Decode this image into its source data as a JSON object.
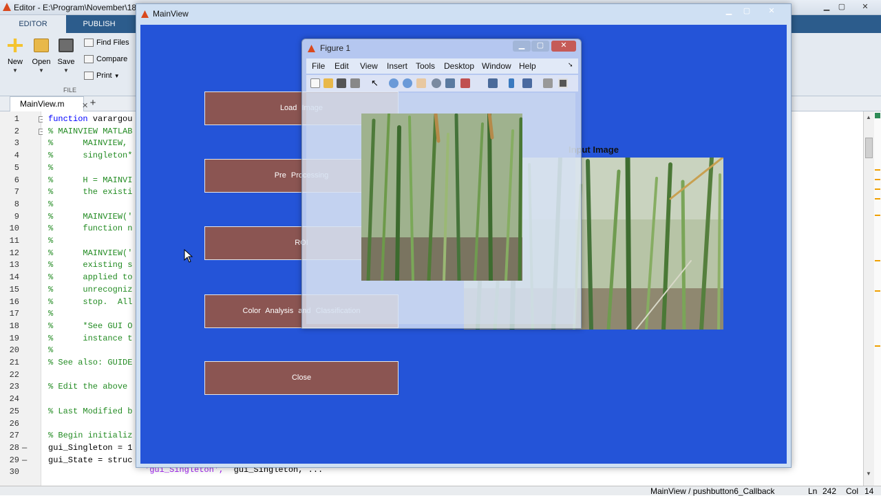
{
  "editor": {
    "title": "Editor - E:\\Program\\November\\18-",
    "tabs": [
      "EDITOR",
      "PUBLISH"
    ],
    "toolbar": {
      "new_label": "New",
      "open_label": "Open",
      "save_label": "Save",
      "find_files_label": "Find Files",
      "compare_label": "Compare",
      "print_label": "Print",
      "group_label": "FILE"
    },
    "doc_tab": "MainView.m",
    "doc_tab_close": "✕",
    "doc_tab_add": "+",
    "line_numbers": [
      "1",
      "2",
      "3",
      "4",
      "5",
      "6",
      "7",
      "8",
      "9",
      "10",
      "11",
      "12",
      "13",
      "14",
      "15",
      "16",
      "17",
      "18",
      "19",
      "20",
      "21",
      "22",
      "23",
      "24",
      "25",
      "26",
      "27",
      "28",
      "29",
      "30"
    ],
    "code_lines": [
      "function varargou",
      "% MAINVIEW MATLAB",
      "%      MAINVIEW,",
      "%      singleton*",
      "%",
      "%      H = MAINVI",
      "%      the existi",
      "%",
      "%      MAINVIEW('",
      "%      function n",
      "%",
      "%      MAINVIEW('",
      "%      existing s",
      "%      applied to",
      "%      unrecogniz",
      "%      stop.  All",
      "%",
      "%      *See GUI O",
      "%      instance t",
      "%",
      "% See also: GUIDE",
      "",
      "% Edit the above",
      "",
      "% Last Modified b",
      "",
      "% Begin initializ",
      "gui_Singleton = 1",
      "gui_State = struc",
      ""
    ],
    "line30_string": "'gui_Singleton',",
    "line30_rest": "  gui_Singleton, ...",
    "status": {
      "function": "MainView / pushbutton6_Callback",
      "ln_label": "Ln",
      "ln_value": "242",
      "col_label": "Col",
      "col_value": "14"
    },
    "colors": {
      "toolstrip_tab_bg": "#2c5c8c",
      "keyword": "#0000ff",
      "comment": "#228b22",
      "string": "#a020f0"
    }
  },
  "mainview": {
    "title": "MainView",
    "background_color": "#2454d8",
    "buttons": [
      "Load  Image",
      "Pre  Processing",
      "ROI",
      "Color  Analysis  and  Classification",
      "Close"
    ],
    "button_color": "#8b5552",
    "axes_title": "Input Image"
  },
  "figure1": {
    "title": "Figure 1",
    "menu": [
      "File",
      "Edit",
      "View",
      "Insert",
      "Tools",
      "Desktop",
      "Window",
      "Help"
    ]
  },
  "icons": {
    "new": "new-file-icon",
    "open": "open-folder-icon",
    "save": "save-icon",
    "cursor": "mouse-pointer-icon"
  }
}
